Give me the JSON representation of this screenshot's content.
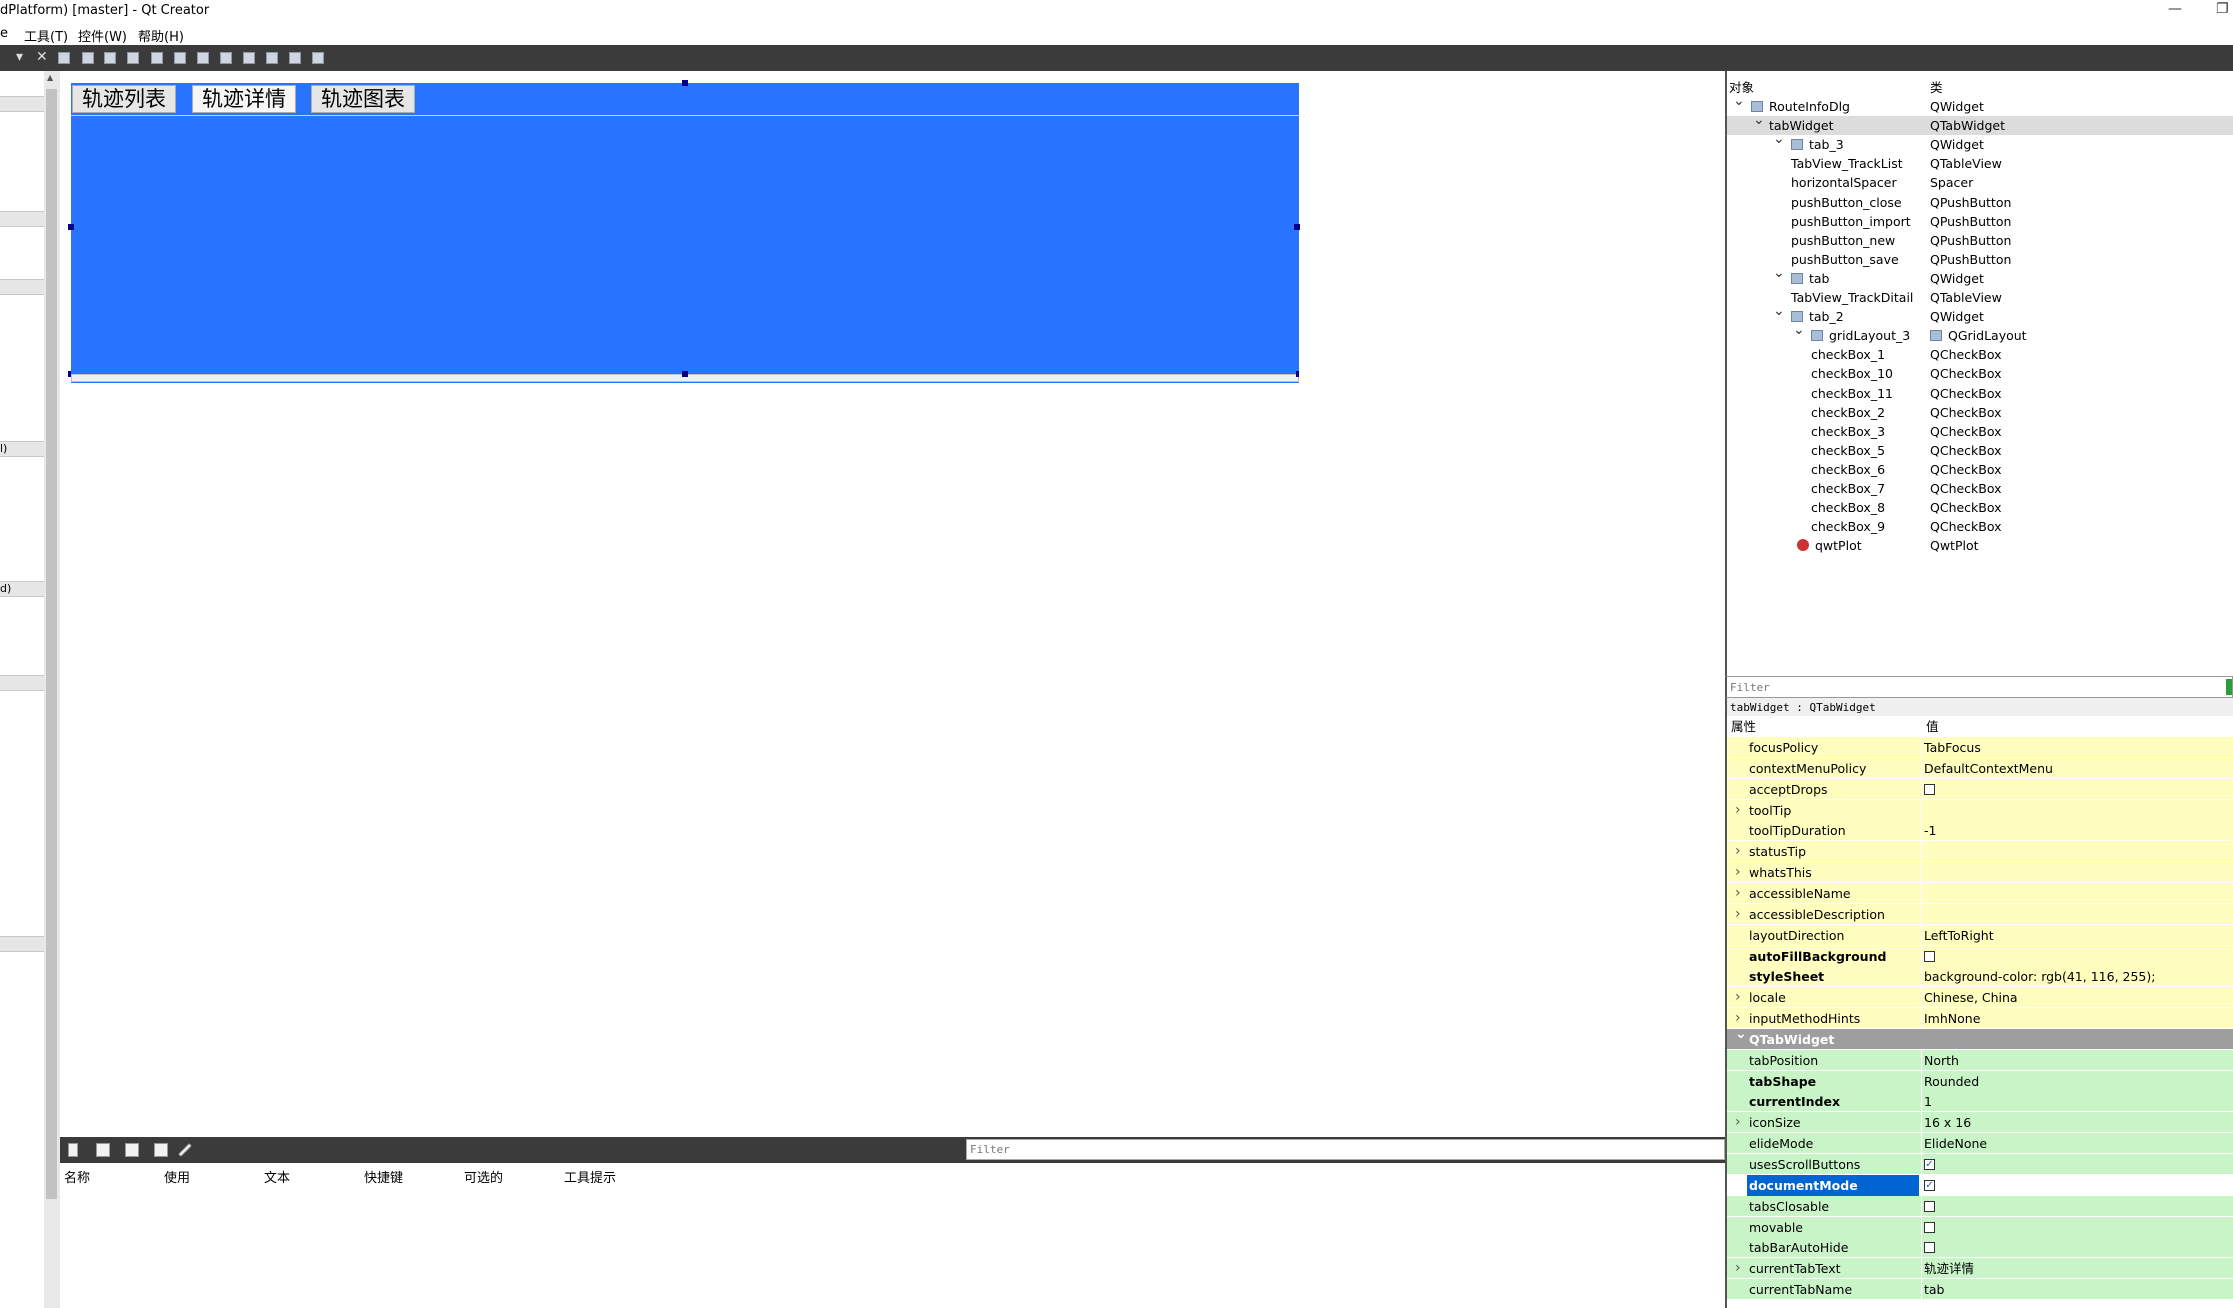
{
  "window": {
    "title": "dPlatform) [master] - Qt Creator",
    "minimize_glyph": "—",
    "restore_glyph": "❐"
  },
  "menu": {
    "items": [
      "e",
      "工具(T)",
      "控件(W)",
      "帮助(H)"
    ]
  },
  "toolbar": {
    "dropdown_glyph": "▾",
    "close_glyph": "✕"
  },
  "left_panel": {
    "labels": [
      "l)",
      "d)"
    ],
    "scroll_up_glyph": "▲"
  },
  "form": {
    "background_color": "#2974ff",
    "tabs": [
      "轨迹列表",
      "轨迹详情",
      "轨迹图表"
    ],
    "current_tab_index": 1
  },
  "action_editor": {
    "filter_placeholder": "Filter",
    "columns": [
      "名称",
      "使用",
      "文本",
      "快捷键",
      "可选的",
      "工具提示"
    ]
  },
  "object_inspector": {
    "header_object": "对象",
    "header_class": "类",
    "rows": [
      {
        "name": "RouteInfoDlg",
        "class": "QWidget",
        "level": 0,
        "expanded": true,
        "icon": "widget-icon"
      },
      {
        "name": "tabWidget",
        "class": "QTabWidget",
        "level": 1,
        "expanded": true,
        "selected": true
      },
      {
        "name": "tab_3",
        "class": "QWidget",
        "level": 2,
        "expanded": true,
        "icon": "widget-icon"
      },
      {
        "name": "TabView_TrackList",
        "class": "QTableView",
        "level": 3
      },
      {
        "name": "horizontalSpacer",
        "class": "Spacer",
        "level": 3
      },
      {
        "name": "pushButton_close",
        "class": "QPushButton",
        "level": 3
      },
      {
        "name": "pushButton_import",
        "class": "QPushButton",
        "level": 3
      },
      {
        "name": "pushButton_new",
        "class": "QPushButton",
        "level": 3
      },
      {
        "name": "pushButton_save",
        "class": "QPushButton",
        "level": 3
      },
      {
        "name": "tab",
        "class": "QWidget",
        "level": 2,
        "expanded": true,
        "icon": "widget-icon"
      },
      {
        "name": "TabView_TrackDitail",
        "class": "QTableView",
        "level": 3
      },
      {
        "name": "tab_2",
        "class": "QWidget",
        "level": 2,
        "expanded": true,
        "icon": "widget-icon"
      },
      {
        "name": "gridLayout_3",
        "class": "QGridLayout",
        "level": 3,
        "expanded": true,
        "icon": "grid-layout-icon"
      },
      {
        "name": "checkBox_1",
        "class": "QCheckBox",
        "level": 4
      },
      {
        "name": "checkBox_10",
        "class": "QCheckBox",
        "level": 4
      },
      {
        "name": "checkBox_11",
        "class": "QCheckBox",
        "level": 4
      },
      {
        "name": "checkBox_2",
        "class": "QCheckBox",
        "level": 4
      },
      {
        "name": "checkBox_3",
        "class": "QCheckBox",
        "level": 4
      },
      {
        "name": "checkBox_5",
        "class": "QCheckBox",
        "level": 4
      },
      {
        "name": "checkBox_6",
        "class": "QCheckBox",
        "level": 4
      },
      {
        "name": "checkBox_7",
        "class": "QCheckBox",
        "level": 4
      },
      {
        "name": "checkBox_8",
        "class": "QCheckBox",
        "level": 4
      },
      {
        "name": "checkBox_9",
        "class": "QCheckBox",
        "level": 4
      },
      {
        "name": "qwtPlot",
        "class": "QwtPlot",
        "level": 3,
        "icon": "qwt-plot-icon"
      }
    ]
  },
  "property_editor": {
    "filter_placeholder": "Filter",
    "object_class_label": "tabWidget : QTabWidget",
    "header_property": "属性",
    "header_value": "值",
    "rows": [
      {
        "name": "focusPolicy",
        "value": "TabFocus",
        "color": "yellow"
      },
      {
        "name": "contextMenuPolicy",
        "value": "DefaultContextMenu",
        "color": "yellow"
      },
      {
        "name": "acceptDrops",
        "value": "",
        "color": "yellow",
        "checkbox": false
      },
      {
        "name": "toolTip",
        "value": "",
        "color": "yellow",
        "expandable": true
      },
      {
        "name": "toolTipDuration",
        "value": "-1",
        "color": "yellow"
      },
      {
        "name": "statusTip",
        "value": "",
        "color": "yellow",
        "expandable": true
      },
      {
        "name": "whatsThis",
        "value": "",
        "color": "yellow",
        "expandable": true
      },
      {
        "name": "accessibleName",
        "value": "",
        "color": "yellow",
        "expandable": true
      },
      {
        "name": "accessibleDescription",
        "value": "",
        "color": "yellow",
        "expandable": true
      },
      {
        "name": "layoutDirection",
        "value": "LeftToRight",
        "color": "yellow"
      },
      {
        "name": "autoFillBackground",
        "value": "",
        "color": "yellow",
        "checkbox": false,
        "bold": true
      },
      {
        "name": "styleSheet",
        "value": "background-color: rgb(41, 116, 255);",
        "color": "yellow",
        "bold": true
      },
      {
        "name": "locale",
        "value": "Chinese, China",
        "color": "yellow",
        "expandable": true
      },
      {
        "name": "inputMethodHints",
        "value": "ImhNone",
        "color": "yellow",
        "expandable": true
      },
      {
        "name": "QTabWidget",
        "value": "",
        "color": "section"
      },
      {
        "name": "tabPosition",
        "value": "North",
        "color": "green"
      },
      {
        "name": "tabShape",
        "value": "Rounded",
        "color": "green",
        "bold": true
      },
      {
        "name": "currentIndex",
        "value": "1",
        "color": "green",
        "bold": true
      },
      {
        "name": "iconSize",
        "value": "16 x 16",
        "color": "green",
        "expandable": true
      },
      {
        "name": "elideMode",
        "value": "ElideNone",
        "color": "green"
      },
      {
        "name": "usesScrollButtons",
        "value": "",
        "color": "green",
        "checkbox": true
      },
      {
        "name": "documentMode",
        "value": "",
        "color": "green",
        "checkbox": true,
        "selected": true
      },
      {
        "name": "tabsClosable",
        "value": "",
        "color": "green",
        "checkbox": false
      },
      {
        "name": "movable",
        "value": "",
        "color": "green",
        "checkbox": false
      },
      {
        "name": "tabBarAutoHide",
        "value": "",
        "color": "green",
        "checkbox": false
      },
      {
        "name": "currentTabText",
        "value": "轨迹详情",
        "color": "green",
        "expandable": true
      },
      {
        "name": "currentTabName",
        "value": "tab",
        "color": "green"
      }
    ]
  }
}
